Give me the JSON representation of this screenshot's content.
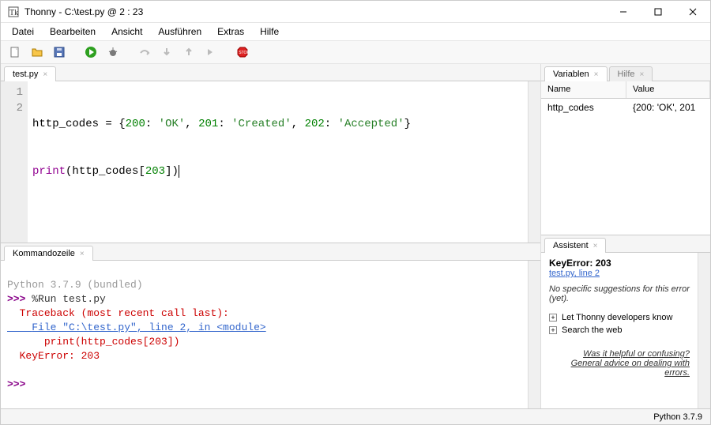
{
  "window": {
    "title": "Thonny  -  C:\\test.py  @  2 : 23"
  },
  "menu": [
    "Datei",
    "Bearbeiten",
    "Ansicht",
    "Ausführen",
    "Extras",
    "Hilfe"
  ],
  "toolbar_icons": [
    "new-file-icon",
    "open-file-icon",
    "save-file-icon",
    "run-icon",
    "debug-icon",
    "step-over-icon",
    "step-into-icon",
    "step-out-icon",
    "resume-icon",
    "stop-icon"
  ],
  "editor": {
    "tab": "test.py",
    "lines": [
      {
        "n": "1",
        "html": "<span class='name'>http_codes</span> <span class='op'>=</span> <span class='punct'>{</span><span class='num'>200</span><span class='punct'>:</span> <span class='str'>'OK'</span><span class='punct'>,</span> <span class='num'>201</span><span class='punct'>:</span> <span class='str'>'Created'</span><span class='punct'>,</span> <span class='num'>202</span><span class='punct'>:</span> <span class='str'>'Accepted'</span><span class='punct'>}</span>"
      },
      {
        "n": "2",
        "html": "<span class='func'>print</span><span class='punct'>(</span><span class='name'>http_codes</span><span class='punct'>[</span><span class='num'>203</span><span class='punct'>])</span><span class='cursor'></span>"
      }
    ]
  },
  "shell": {
    "tab": "Kommandozeile",
    "banner": "Python 3.7.9 (bundled)",
    "prompt": ">>>",
    "run_cmd": "%Run test.py",
    "tb1": "  Traceback (most recent call last):",
    "tb_file": "    File \"C:\\test.py\", line 2, in <module>",
    "tb_code": "      print(http_codes[203])",
    "tb_err": "  KeyError: 203"
  },
  "variables": {
    "tabs": [
      "Variablen",
      "Hilfe"
    ],
    "cols": {
      "name": "Name",
      "value": "Value"
    },
    "rows": [
      {
        "name": "http_codes",
        "value": "{200: 'OK', 201"
      }
    ]
  },
  "assistant": {
    "tab": "Assistent",
    "title": "KeyError: 203",
    "loc": "test.py, line 2",
    "msg": "No specific suggestions for this error (yet).",
    "sugg1": "Let Thonny developers know",
    "sugg2": "Search the web",
    "help1": "Was it helpful or confusing?",
    "help2": "General advice on dealing with errors."
  },
  "status": "Python 3.7.9"
}
